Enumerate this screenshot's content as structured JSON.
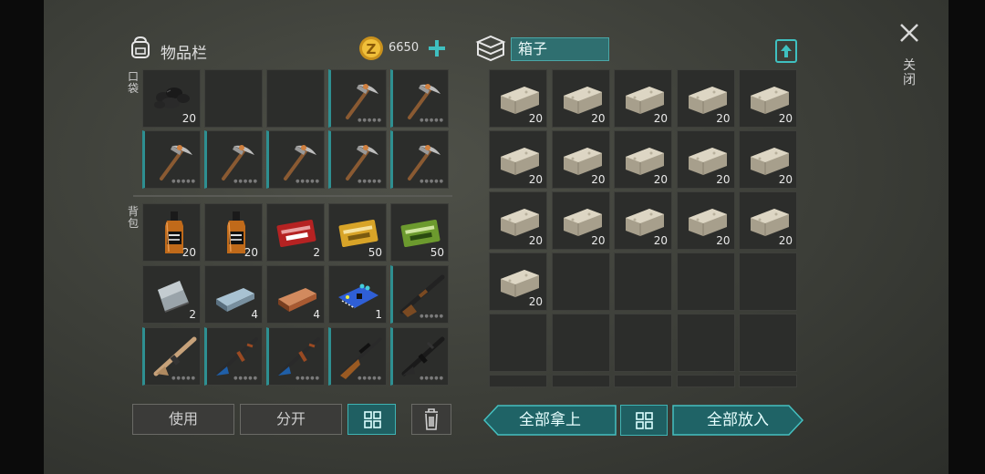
{
  "inventory": {
    "title": "物品栏",
    "currency_amount": "6650",
    "pocket_label": "口袋",
    "backpack_label": "背包",
    "pocket_slots": [
      {
        "item": "coal",
        "count": "20",
        "bar": false
      },
      {
        "item": "empty",
        "count": "",
        "bar": false
      },
      {
        "item": "empty",
        "count": "",
        "bar": false
      },
      {
        "item": "pickaxe",
        "count": "",
        "bar": true
      },
      {
        "item": "pickaxe",
        "count": "",
        "bar": true
      },
      {
        "item": "pickaxe",
        "count": "",
        "bar": true
      },
      {
        "item": "pickaxe",
        "count": "",
        "bar": true
      },
      {
        "item": "pickaxe",
        "count": "",
        "bar": true
      },
      {
        "item": "pickaxe",
        "count": "",
        "bar": true
      },
      {
        "item": "pickaxe",
        "count": "",
        "bar": true
      }
    ],
    "backpack_slots": [
      {
        "item": "whiskey",
        "count": "20",
        "bar": false
      },
      {
        "item": "whiskey",
        "count": "20",
        "bar": false
      },
      {
        "item": "coupon-red",
        "count": "2",
        "bar": false
      },
      {
        "item": "coupon-gold",
        "count": "50",
        "bar": false
      },
      {
        "item": "coupon-green",
        "count": "50",
        "bar": false
      },
      {
        "item": "sheet-metal",
        "count": "2",
        "bar": false
      },
      {
        "item": "iron-ingot",
        "count": "4",
        "bar": false
      },
      {
        "item": "copper-ingot",
        "count": "4",
        "bar": false
      },
      {
        "item": "circuit-board",
        "count": "1",
        "bar": false
      },
      {
        "item": "shotgun",
        "count": "",
        "bar": true
      },
      {
        "item": "rifle-tan",
        "count": "",
        "bar": true
      },
      {
        "item": "ak-rifle",
        "count": "",
        "bar": true
      },
      {
        "item": "ak-rifle",
        "count": "",
        "bar": true
      },
      {
        "item": "hunting-rifle",
        "count": "",
        "bar": true
      },
      {
        "item": "assault-rifle",
        "count": "",
        "bar": true
      }
    ],
    "buttons": {
      "use": "使用",
      "split": "分开"
    }
  },
  "box": {
    "title": "箱子",
    "slots": [
      {
        "item": "stone",
        "count": "20"
      },
      {
        "item": "stone",
        "count": "20"
      },
      {
        "item": "stone",
        "count": "20"
      },
      {
        "item": "stone",
        "count": "20"
      },
      {
        "item": "stone",
        "count": "20"
      },
      {
        "item": "stone",
        "count": "20"
      },
      {
        "item": "stone",
        "count": "20"
      },
      {
        "item": "stone",
        "count": "20"
      },
      {
        "item": "stone",
        "count": "20"
      },
      {
        "item": "stone",
        "count": "20"
      },
      {
        "item": "stone",
        "count": "20"
      },
      {
        "item": "stone",
        "count": "20"
      },
      {
        "item": "stone",
        "count": "20"
      },
      {
        "item": "stone",
        "count": "20"
      },
      {
        "item": "stone",
        "count": "20"
      },
      {
        "item": "stone",
        "count": "20"
      },
      {
        "item": "empty",
        "count": ""
      },
      {
        "item": "empty",
        "count": ""
      },
      {
        "item": "empty",
        "count": ""
      },
      {
        "item": "empty",
        "count": ""
      },
      {
        "item": "empty",
        "count": ""
      },
      {
        "item": "empty",
        "count": ""
      },
      {
        "item": "empty",
        "count": ""
      },
      {
        "item": "empty",
        "count": ""
      },
      {
        "item": "empty",
        "count": ""
      }
    ],
    "take_all_label": "全部拿上",
    "put_all_label": "全部放入"
  },
  "close_label": "关闭",
  "colors": {
    "accent": "#2e8f91",
    "panel": "#2c2d2b",
    "background": "#41433d"
  }
}
